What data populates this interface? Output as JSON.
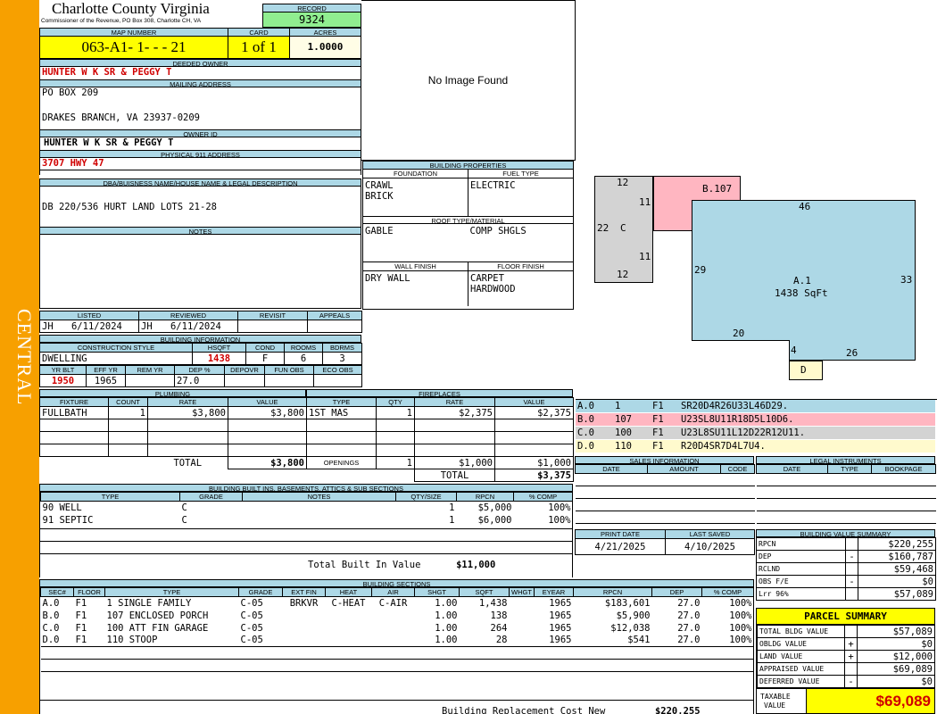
{
  "sidebar": {
    "label": "CENTRAL"
  },
  "county": {
    "title": "Charlotte County Virginia",
    "subtitle": "Commissioner of the Revenue, PO Box 308, Charlotte CH, VA"
  },
  "record": {
    "label": "RECORD",
    "value": "9324"
  },
  "map": {
    "map_label": "MAP NUMBER",
    "map_value": "063-A1- 1- - - 21",
    "card_label": "CARD",
    "card_value": "1 of 1",
    "acres_label": "ACRES",
    "acres_value": "1.0000"
  },
  "owner": {
    "deeded_label": "DEEDED OWNER",
    "deeded_value": "HUNTER W K SR & PEGGY T",
    "mailing_label": "MAILING ADDRESS",
    "mailing_line1": "PO BOX 209",
    "mailing_line2": "DRAKES BRANCH, VA 23937-0209",
    "ownerid_label": "OWNER ID",
    "ownerid_value": "HUNTER W K SR & PEGGY T",
    "phys_label": "PHYSICAL 911 ADDRESS",
    "phys_value": "3707 HWY 47"
  },
  "legal": {
    "label": "DBA/BUISNESS NAME/HOUSE NAME & LEGAL DESCRIPTION",
    "value": "DB 220/536 HURT LAND LOTS 21-28",
    "notes_label": "NOTES"
  },
  "photo": {
    "text": "No Image Found"
  },
  "listed": {
    "listed_label": "LISTED",
    "reviewed_label": "REVIEWED",
    "revisit_label": "REVISIT",
    "appeals_label": "APPEALS",
    "listed_by": "JH",
    "listed_date": "6/11/2024",
    "reviewed_by": "JH",
    "reviewed_date": "6/11/2024"
  },
  "building_info": {
    "label": "BUILDING INFORMATION",
    "h_style": "CONSTRUCTION STYLE",
    "h_hsqft": "HSQFT",
    "h_cond": "COND",
    "h_rooms": "ROOMS",
    "h_bdrms": "BDRMS",
    "style": "DWELLING",
    "hsqft": "1438",
    "cond": "F",
    "rooms": "6",
    "bdrms": "3",
    "h_yrblt": "YR BLT",
    "h_effyr": "EFF YR",
    "h_remyr": "REM YR",
    "h_dep": "DEP %",
    "h_depovr": "DEPOVR",
    "h_funobs": "FUN OBS",
    "h_ecoobs": "ECO OBS",
    "yrblt": "1950",
    "effyr": "1965",
    "dep": "27.0"
  },
  "props": {
    "label": "BUILDING PROPERTIES",
    "foundation_label": "FOUNDATION",
    "fuel_label": "FUEL TYPE",
    "foundation1": "CRAWL",
    "foundation2": "BRICK",
    "fuel": "ELECTRIC",
    "roof_label": "ROOF TYPE/MATERIAL",
    "roof_type": "GABLE",
    "roof_mat": "COMP SHGLS",
    "wall_label": "WALL FINISH",
    "floor_label": "FLOOR FINISH",
    "wall": "DRY WALL",
    "floor1": "CARPET",
    "floor2": "HARDWOOD"
  },
  "plumbing": {
    "label": "PLUMBING",
    "headers": [
      "FIXTURE",
      "COUNT",
      "RATE",
      "VALUE"
    ],
    "rows": [
      [
        "FULLBATH",
        "1",
        "$3,800",
        "$3,800"
      ]
    ],
    "total_label": "TOTAL",
    "total": "$3,800"
  },
  "fireplaces": {
    "label": "FIREPLACES",
    "headers": [
      "TYPE",
      "QTY",
      "RATE",
      "VALUE"
    ],
    "rows": [
      [
        "1ST MAS",
        "1",
        "$2,375",
        "$2,375"
      ]
    ],
    "openings_label": "OPENINGS",
    "openings_qty": "1",
    "openings_rate": "$1,000",
    "openings_value": "$1,000",
    "total_label": "TOTAL",
    "total": "$3,375"
  },
  "builtins": {
    "label": "BUILDING BUILT INS, BASEMENTS, ATTICS & SUB SECTIONS",
    "headers": [
      "TYPE",
      "GRADE",
      "NOTES",
      "QTY/SIZE",
      "RPCN",
      "% COMP"
    ],
    "rows": [
      [
        "90 WELL",
        "C",
        "",
        "1",
        "$5,000",
        "100%"
      ],
      [
        "91 SEPTIC",
        "C",
        "",
        "1",
        "$6,000",
        "100%"
      ]
    ],
    "total_label": "Total Built In Value",
    "total": "$11,000"
  },
  "sections": {
    "label": "BUILDING SECTIONS",
    "headers": [
      "SEC#",
      "FLOOR",
      "TYPE",
      "GRADE",
      "EXT FIN",
      "HEAT",
      "AIR",
      "SHGT",
      "SQFT",
      "WHGT",
      "EYEAR",
      "RPCN",
      "DEP",
      "% COMP"
    ],
    "rows": [
      [
        "A.0",
        "F1",
        "1 SINGLE FAMILY",
        "C-05",
        "BRKVR",
        "C-HEAT",
        "C-AIR",
        "1.00",
        "1,438",
        "",
        "1965",
        "$183,601",
        "27.0",
        "100%"
      ],
      [
        "B.0",
        "F1",
        "107 ENCLOSED PORCH",
        "C-05",
        "",
        "",
        "",
        "1.00",
        "138",
        "",
        "1965",
        "$5,900",
        "27.0",
        "100%"
      ],
      [
        "C.0",
        "F1",
        "100 ATT FIN GARAGE",
        "C-05",
        "",
        "",
        "",
        "1.00",
        "264",
        "",
        "1965",
        "$12,038",
        "27.0",
        "100%"
      ],
      [
        "D.0",
        "F1",
        "110 STOOP",
        "C-05",
        "",
        "",
        "",
        "1.00",
        "28",
        "",
        "1965",
        "$541",
        "27.0",
        "100%"
      ]
    ],
    "total_label": "Building Replacement Cost New",
    "total": "$220,255"
  },
  "sketch": {
    "labels": {
      "top_12": "12",
      "left_22": "22",
      "c_label": "C",
      "mid_11a": "11",
      "mid_11b": "11",
      "bottom_12": "12",
      "b_label": "B.107",
      "a_46": "46",
      "a_29": "29",
      "a_33": "33",
      "a_label": "A.1",
      "a_area": "1438 SqFt",
      "a_20": "20",
      "a_4": "4",
      "a_26": "26",
      "d_label": "D"
    },
    "colors": {
      "a": "#add8e6",
      "b": "#ffb6c1",
      "c": "#d3d3d3",
      "d": "#fffacd"
    }
  },
  "legend": [
    {
      "sec": "A.0",
      "code": "1",
      "floor": "F1",
      "desc": "SR20D4R26U33L46D29.",
      "color": "#add8e6"
    },
    {
      "sec": "B.0",
      "code": "107",
      "floor": "F1",
      "desc": "U23SL8U11R18D5L10D6.",
      "color": "#ffb6c1"
    },
    {
      "sec": "C.0",
      "code": "100",
      "floor": "F1",
      "desc": "U23L8SU11L12D22R12U11.",
      "color": "#d3d3d3"
    },
    {
      "sec": "D.0",
      "code": "110",
      "floor": "F1",
      "desc": "R20D4SR7D4L7U4.",
      "color": "#fffacd"
    }
  ],
  "sales": {
    "label": "SALES INFORMATION",
    "headers": [
      "DATE",
      "AMOUNT",
      "CODE"
    ]
  },
  "legal_instr": {
    "label": "LEGAL INSTRUMENTS",
    "headers": [
      "DATE",
      "TYPE",
      "BOOKPAGE"
    ]
  },
  "print": {
    "print_label": "PRINT DATE",
    "saved_label": "LAST SAVED",
    "print_date": "4/21/2025",
    "saved_date": "4/10/2025"
  },
  "bvs": {
    "label": "BUILDING VALUE SUMMARY",
    "rows": [
      [
        "RPCN",
        "",
        "$220,255"
      ],
      [
        "DEP",
        "-",
        "$160,787"
      ],
      [
        "RCLND",
        "",
        "$59,468"
      ],
      [
        "OBS F/E",
        "-",
        "$0"
      ],
      [
        "Lrr  96%",
        "",
        "$57,089"
      ]
    ]
  },
  "parcel": {
    "label": "PARCEL SUMMARY",
    "rows": [
      [
        "TOTAL BLDG VALUE",
        "",
        "$57,089"
      ],
      [
        "OBLDG VALUE",
        "+",
        "$0"
      ],
      [
        "LAND VALUE",
        "+",
        "$12,000"
      ],
      [
        "APPRAISED VALUE",
        "",
        "$69,089"
      ],
      [
        "DEFERRED VALUE",
        "-",
        "$0"
      ]
    ],
    "taxable_label1": "TAXABLE",
    "taxable_label2": "VALUE",
    "taxable_value": "$69,089"
  }
}
